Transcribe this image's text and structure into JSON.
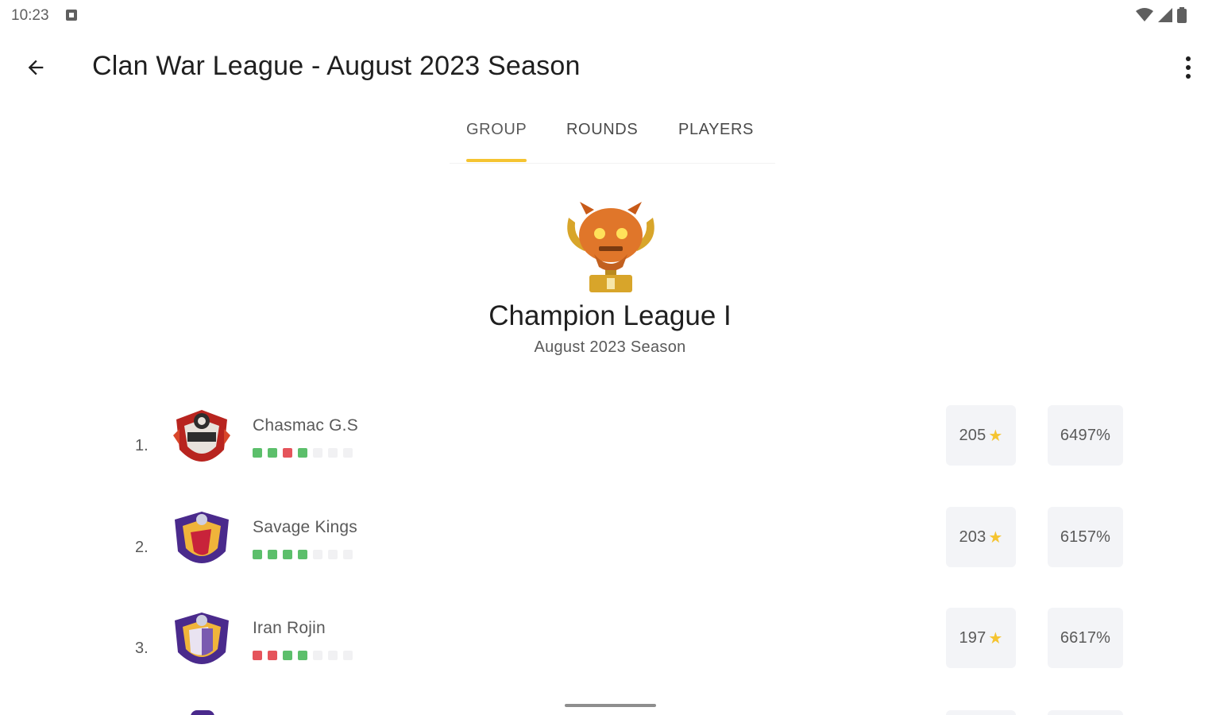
{
  "status_bar": {
    "time": "10:23",
    "icons": [
      "notification-icon",
      "wifi-icon",
      "signal-icon",
      "battery-icon"
    ]
  },
  "app_bar": {
    "title": "Clan War League - August 2023 Season",
    "back_icon": "arrow-back-icon",
    "overflow_icon": "more-vert-icon"
  },
  "tabs": [
    {
      "label": "GROUP",
      "active": true
    },
    {
      "label": "ROUNDS",
      "active": false
    },
    {
      "label": "PLAYERS",
      "active": false
    }
  ],
  "league": {
    "name": "Champion League I",
    "season": "August 2023 Season",
    "icon": "trophy-icon"
  },
  "colors": {
    "accent": "#f5c431",
    "win": "#5cbf6b",
    "loss": "#e5545b",
    "pending": "#f1f1f3",
    "stat_bg": "#f3f4f7"
  },
  "clans": [
    {
      "rank": "1.",
      "name": "Chasmac G.S",
      "badge": "red-clan-badge",
      "results": [
        "win",
        "win",
        "loss",
        "win",
        "pending",
        "pending",
        "pending"
      ],
      "stars": "205",
      "percentage": "6497%"
    },
    {
      "rank": "2.",
      "name": "Savage Kings",
      "badge": "purple-clan-badge",
      "results": [
        "win",
        "win",
        "win",
        "win",
        "pending",
        "pending",
        "pending"
      ],
      "stars": "203",
      "percentage": "6157%"
    },
    {
      "rank": "3.",
      "name": "Iran Rojin",
      "badge": "purple-clan-badge",
      "results": [
        "loss",
        "loss",
        "win",
        "win",
        "pending",
        "pending",
        "pending"
      ],
      "stars": "197",
      "percentage": "6617%"
    }
  ]
}
